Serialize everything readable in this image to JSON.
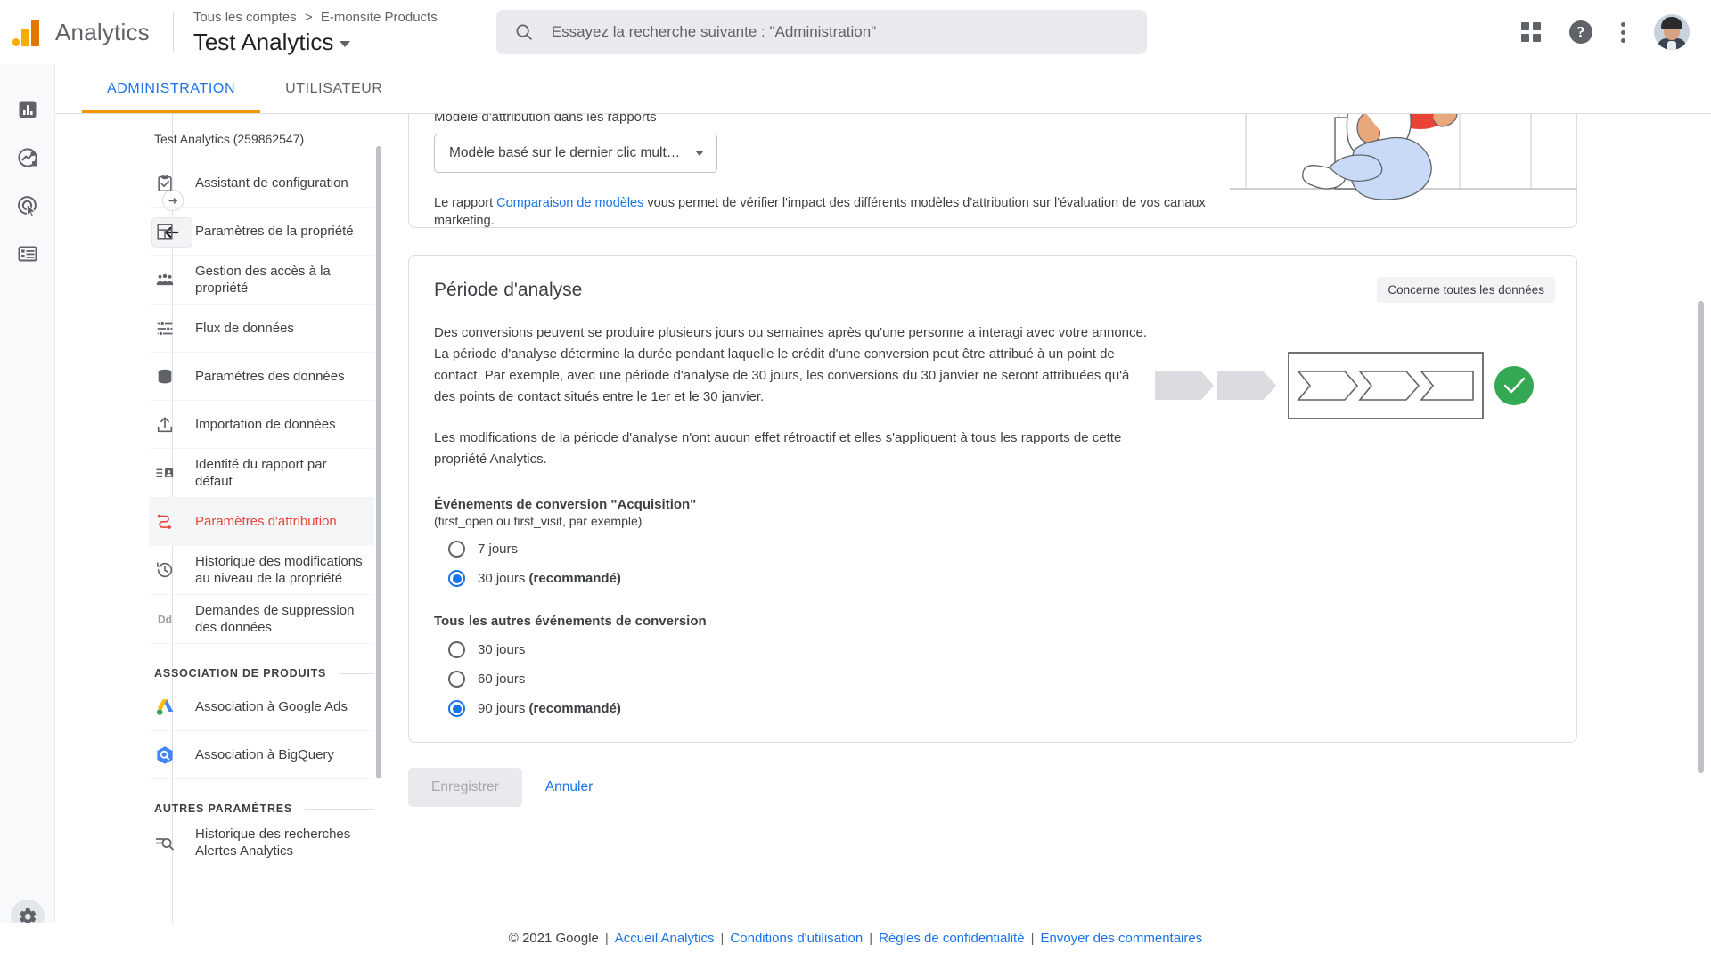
{
  "header": {
    "brand": "Analytics",
    "breadcrumb": {
      "root": "Tous les comptes",
      "separator": ">",
      "account": "E-monsite Products"
    },
    "property_name": "Test Analytics",
    "search_placeholder": "Essayez la recherche suivante : \"Administration\"",
    "help_glyph": "?"
  },
  "tabs": [
    {
      "label": "ADMINISTRATION",
      "active": true
    },
    {
      "label": "UTILISATEUR",
      "active": false
    }
  ],
  "rail": {
    "items": [
      {
        "name": "home-icon"
      },
      {
        "name": "insights-icon"
      },
      {
        "name": "advertising-icon"
      },
      {
        "name": "library-icon"
      }
    ],
    "gear": "gear-icon"
  },
  "sidebar": {
    "title": "Test Analytics (259862547)",
    "items": [
      {
        "label": "Assistant de configuration",
        "icon": "checklist-icon",
        "selected": false
      },
      {
        "label": "Paramètres de la propriété",
        "icon": "layout-icon",
        "selected": false
      },
      {
        "label": "Gestion des accès à la propriété",
        "icon": "people-icon",
        "selected": false
      },
      {
        "label": "Flux de données",
        "icon": "datastream-icon",
        "selected": false
      },
      {
        "label": "Paramètres des données",
        "icon": "database-icon",
        "selected": false
      },
      {
        "label": "Importation de données",
        "icon": "upload-icon",
        "selected": false
      },
      {
        "label": "Identité du rapport par défaut",
        "icon": "report-identity-icon",
        "selected": false
      },
      {
        "label": "Paramètres d'attribution",
        "icon": "attribution-icon",
        "selected": true
      },
      {
        "label": "Historique des modifications au niveau de la propriété",
        "icon": "history-icon",
        "selected": false
      },
      {
        "label": "Demandes de suppression des données",
        "icon": "dd-icon",
        "selected": false
      }
    ],
    "section_products": "ASSOCIATION DE PRODUITS",
    "product_items": [
      {
        "label": "Association à Google Ads",
        "icon": "google-ads-icon"
      },
      {
        "label": "Association à BigQuery",
        "icon": "bigquery-icon"
      }
    ],
    "section_other": "AUTRES PARAMÈTRES",
    "other_items": [
      {
        "label": "Historique des recherches Alertes Analytics",
        "icon": "search-history-icon"
      }
    ]
  },
  "attribution": {
    "field_label": "Modèle d'attribution dans les rapports",
    "selected_model": "Modèle basé sur le dernier clic mult…",
    "helper_pre": "Le rapport ",
    "helper_link": "Comparaison de modèles",
    "helper_post": " vous permet de vérifier l'impact des différents modèles d'attribution sur l'évaluation de vos canaux marketing."
  },
  "lookback": {
    "title": "Période d'analyse",
    "badge": "Concerne toutes les données",
    "paragraph1": "Des conversions peuvent se produire plusieurs jours ou semaines après qu'une personne a interagi avec votre annonce. La période d'analyse détermine la durée pendant laquelle le crédit d'une conversion peut être attribué à un point de contact. Par exemple, avec une période d'analyse de 30 jours, les conversions du 30 janvier ne seront attribuées qu'à des points de contact situés entre le 1er et le 30 janvier.",
    "paragraph2": "Les modifications de la période d'analyse n'ont aucun effet rétroactif et elles s'appliquent à tous les rapports de cette propriété Analytics.",
    "acquisition": {
      "title": "Événements de conversion \"Acquisition\"",
      "subtitle": "(first_open ou first_visit, par exemple)",
      "options": [
        {
          "label": "7 jours",
          "bold": "",
          "selected": false
        },
        {
          "label": "30 jours ",
          "bold": "(recommandé)",
          "selected": true
        }
      ]
    },
    "other_events": {
      "title": "Tous les autres événements de conversion",
      "options": [
        {
          "label": "30 jours",
          "bold": "",
          "selected": false
        },
        {
          "label": "60 jours",
          "bold": "",
          "selected": false
        },
        {
          "label": "90 jours ",
          "bold": "(recommandé)",
          "selected": true
        }
      ]
    }
  },
  "actions": {
    "save": "Enregistrer",
    "cancel": "Annuler"
  },
  "footer": {
    "copyright": "© 2021 Google",
    "links": [
      "Accueil Analytics",
      "Conditions d'utilisation",
      "Règles de confidentialité",
      "Envoyer des commentaires"
    ],
    "separator": "|"
  },
  "colors": {
    "accent_blue": "#1a73e8",
    "selected_red": "#e8453c",
    "tab_underline": "#f29900",
    "logo_orange": "#F9AB00",
    "logo_dark_orange": "#E37400",
    "success_green": "#34a853"
  }
}
